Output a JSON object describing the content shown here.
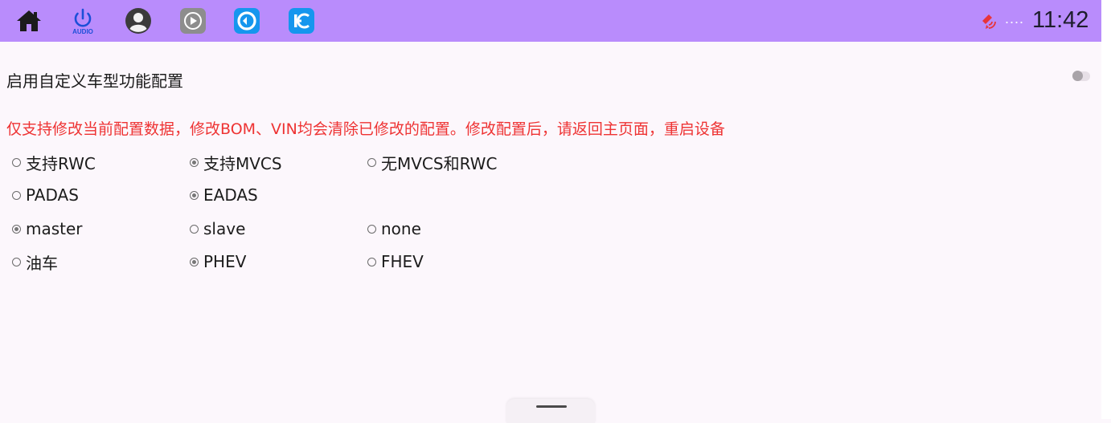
{
  "statusbar": {
    "icons": [
      "home-icon",
      "audio-power-icon",
      "user-avatar-icon",
      "media-play-icon",
      "cycle-app-icon",
      "hc-app-icon"
    ],
    "audio_label": "AUDIO",
    "signal_dots": "....",
    "time": "11:42",
    "colors": {
      "background": "#b98cfc",
      "signal_icon": "#e8343a",
      "audio_icon": "#1b4fd8",
      "app_blue": "#1596ee"
    }
  },
  "settings": {
    "enable_label": "启用自定义车型功能配置",
    "enable_toggle_on": false,
    "warning": "仅支持修改当前配置数据，修改BOM、VIN均会清除已修改的配置。修改配置后，请返回主页面，重启设备",
    "warning_color": "#ee3333",
    "rows": [
      {
        "options": [
          {
            "label": "支持RWC",
            "checked": false
          },
          {
            "label": "支持MVCS",
            "checked": true
          },
          {
            "label": "无MVCS和RWC",
            "checked": false
          }
        ]
      },
      {
        "options": [
          {
            "label": "PADAS",
            "checked": false
          },
          {
            "label": "EADAS",
            "checked": true
          }
        ]
      },
      {
        "options": [
          {
            "label": "master",
            "checked": true
          },
          {
            "label": "slave",
            "checked": false
          },
          {
            "label": "none",
            "checked": false
          }
        ]
      },
      {
        "options": [
          {
            "label": "油车",
            "checked": false
          },
          {
            "label": "PHEV",
            "checked": true
          },
          {
            "label": "FHEV",
            "checked": false
          }
        ]
      }
    ]
  }
}
